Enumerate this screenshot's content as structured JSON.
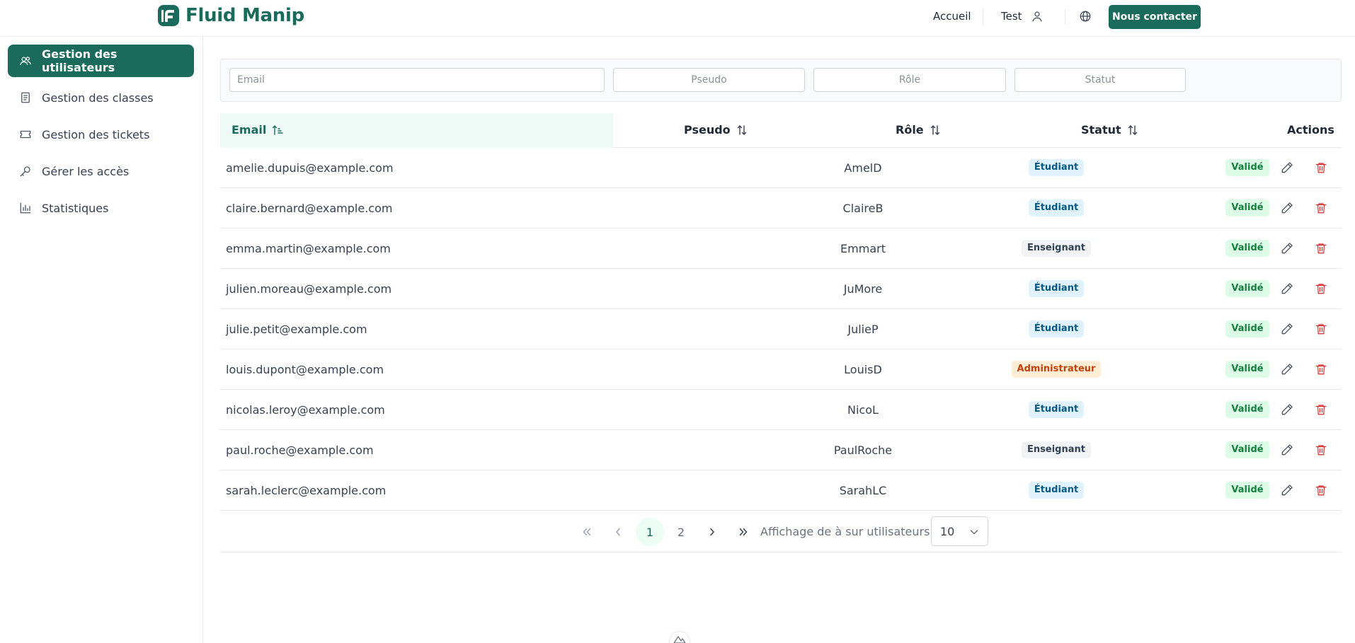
{
  "header": {
    "brand": "Fluid Manip",
    "nav": {
      "home": "Accueil",
      "user": "Test"
    },
    "contact_button": "Nous contacter",
    "icons": {
      "user": "user-icon",
      "language": "globe-icon"
    }
  },
  "sidebar": {
    "items": [
      {
        "label": "Gestion des utilisateurs",
        "icon": "users-icon",
        "active": true
      },
      {
        "label": "Gestion des classes",
        "icon": "book-icon",
        "active": false
      },
      {
        "label": "Gestion des tickets",
        "icon": "ticket-icon",
        "active": false
      },
      {
        "label": "Gérer les accès",
        "icon": "key-icon",
        "active": false
      },
      {
        "label": "Statistiques",
        "icon": "chart-icon",
        "active": false
      }
    ]
  },
  "filters": {
    "email": {
      "placeholder": "Email",
      "value": ""
    },
    "pseudo": {
      "placeholder": "Pseudo",
      "value": ""
    },
    "role": {
      "placeholder": "Rôle",
      "value": ""
    },
    "status": {
      "placeholder": "Statut",
      "value": ""
    }
  },
  "table": {
    "columns": {
      "email": "Email",
      "pseudo": "Pseudo",
      "role": "Rôle",
      "status": "Statut",
      "actions": "Actions"
    },
    "sorted_column": "email",
    "rows": [
      {
        "email": "amelie.dupuis@example.com",
        "pseudo": "AmelD",
        "role": "Étudiant",
        "status": "Validé"
      },
      {
        "email": "claire.bernard@example.com",
        "pseudo": "ClaireB",
        "role": "Étudiant",
        "status": "Validé"
      },
      {
        "email": "emma.martin@example.com",
        "pseudo": "Emmart",
        "role": "Enseignant",
        "status": "Validé"
      },
      {
        "email": "julien.moreau@example.com",
        "pseudo": "JuMore",
        "role": "Étudiant",
        "status": "Validé"
      },
      {
        "email": "julie.petit@example.com",
        "pseudo": "JulieP",
        "role": "Étudiant",
        "status": "Validé"
      },
      {
        "email": "louis.dupont@example.com",
        "pseudo": "LouisD",
        "role": "Administrateur",
        "status": "Validé"
      },
      {
        "email": "nicolas.leroy@example.com",
        "pseudo": "NicoL",
        "role": "Étudiant",
        "status": "Validé"
      },
      {
        "email": "paul.roche@example.com",
        "pseudo": "PaulRoche",
        "role": "Enseignant",
        "status": "Validé"
      },
      {
        "email": "sarah.leclerc@example.com",
        "pseudo": "SarahLC",
        "role": "Étudiant",
        "status": "Validé"
      }
    ]
  },
  "pagination": {
    "first": "«",
    "prev": "‹",
    "pages": [
      "1",
      "2"
    ],
    "current_page": "1",
    "next": "›",
    "last": "»",
    "info": "Affichage de à sur utilisateurs",
    "page_size": "10"
  },
  "colors": {
    "brand": "#1b6b5d",
    "student_badge": "#e0f2fe",
    "teacher_badge": "#f1f3f5",
    "admin_badge": "#ffedd5",
    "validated_badge": "#dcfce7",
    "delete": "#dc2626"
  }
}
